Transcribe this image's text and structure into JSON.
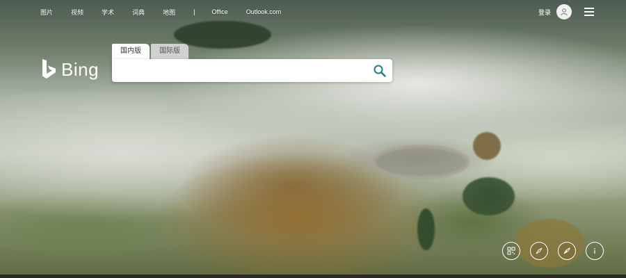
{
  "nav": {
    "items": [
      "图片",
      "视频",
      "学术",
      "词典",
      "地图"
    ],
    "separator": "|",
    "office": "Office",
    "outlook": "Outlook.com"
  },
  "header": {
    "login_label": "登录"
  },
  "logo": {
    "text": "Bing"
  },
  "search": {
    "tabs": [
      {
        "label": "国内版",
        "active": true
      },
      {
        "label": "国际版",
        "active": false
      }
    ],
    "value": "",
    "placeholder": ""
  },
  "icons": {
    "bottom": [
      "qr-code-icon",
      "compass-icon",
      "feather-icon",
      "info-icon"
    ]
  },
  "colors": {
    "search_icon": "#1a7f91",
    "text_on_image": "#ffffff"
  }
}
